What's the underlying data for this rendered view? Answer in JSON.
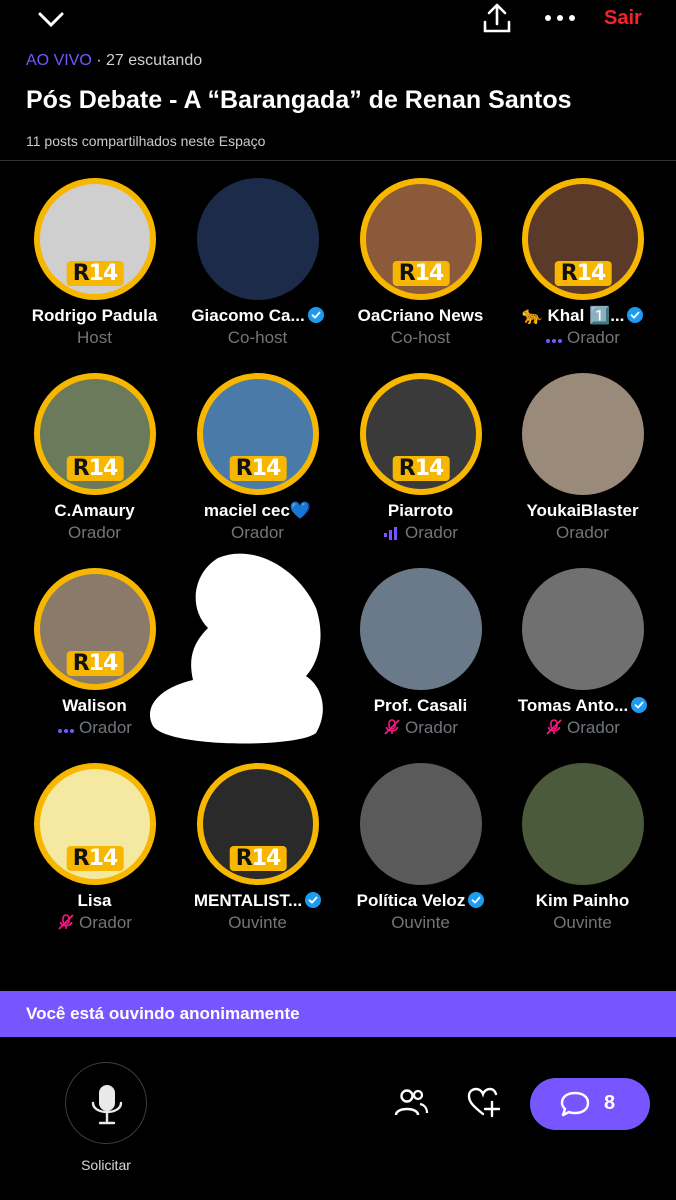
{
  "header": {
    "exit_label": "Sair"
  },
  "space": {
    "live_label": "AO VIVO",
    "separator": "·",
    "listening": "27 escutando",
    "title": "Pós Debate - A “Barangada” de Renan Santos",
    "posts_shared": "11 posts compartilhados neste Espaço"
  },
  "badge": {
    "r": "R",
    "n": "14"
  },
  "participants": [
    {
      "name": "Rodrigo Padula",
      "role": "Host",
      "verified": false,
      "role_icon": "",
      "ring": true,
      "bg": "#cfcfcf"
    },
    {
      "name": "Giacomo Ca...",
      "role": "Co-host",
      "verified": true,
      "role_icon": "",
      "ring": false,
      "bg": "#1c2b4a"
    },
    {
      "name": "OaCriano News",
      "role": "Co-host",
      "verified": false,
      "role_icon": "",
      "ring": true,
      "bg": "#8a5a3a"
    },
    {
      "name": "🐆 Khal 1️⃣...",
      "role": "Orador",
      "verified": true,
      "role_icon": "dots",
      "ring": true,
      "bg": "#5b3a2a"
    },
    {
      "name": "C.Amaury",
      "role": "Orador",
      "verified": false,
      "role_icon": "",
      "ring": true,
      "bg": "#6b7a5a"
    },
    {
      "name": "maciel cec💙",
      "role": "Orador",
      "verified": false,
      "role_icon": "",
      "ring": true,
      "bg": "#4a7aa8"
    },
    {
      "name": "Piarroto",
      "role": "Orador",
      "verified": false,
      "role_icon": "speaking",
      "ring": true,
      "bg": "#3a3a3a"
    },
    {
      "name": "YoukaiBlaster",
      "role": "Orador",
      "verified": false,
      "role_icon": "",
      "ring": false,
      "bg": "#9a8a7a"
    },
    {
      "name": "Walison",
      "role": "Orador",
      "verified": false,
      "role_icon": "dots",
      "ring": true,
      "bg": "#8a7a6a"
    },
    {
      "name": "Prof. Casali",
      "role": "Orador",
      "verified": false,
      "role_icon": "muted",
      "ring": false,
      "bg": "#6a7a8a"
    },
    {
      "name": "Tomas Anto...",
      "role": "Orador",
      "verified": true,
      "role_icon": "muted",
      "ring": false,
      "bg": "#707070"
    },
    {
      "name": "Lisa",
      "role": "Orador",
      "verified": false,
      "role_icon": "muted",
      "ring": true,
      "bg": "#f5e8a0"
    },
    {
      "name": "MENTALIST...",
      "role": "Ouvinte",
      "verified": true,
      "role_icon": "",
      "ring": true,
      "bg": "#2a2a2a"
    },
    {
      "name": "Política Veloz",
      "role": "Ouvinte",
      "verified": true,
      "role_icon": "",
      "ring": false,
      "bg": "#5a5a5a"
    },
    {
      "name": "Kim Painho",
      "role": "Ouvinte",
      "verified": false,
      "role_icon": "",
      "ring": false,
      "bg": "#4a5a3a"
    }
  ],
  "banner": {
    "text": "Você está ouvindo anonimamente"
  },
  "bottom": {
    "request_label": "Solicitar",
    "comment_count": "8"
  },
  "icons": [
    "chevron-down-icon",
    "share-icon",
    "more-icon",
    "mic-icon",
    "people-icon",
    "heart-plus-icon",
    "comment-icon",
    "verified-icon",
    "muted-mic-icon"
  ],
  "colors": {
    "accent": "#7856ff",
    "exit": "#f4212e",
    "verified": "#1d9bf0",
    "ring": "#f7b700"
  }
}
